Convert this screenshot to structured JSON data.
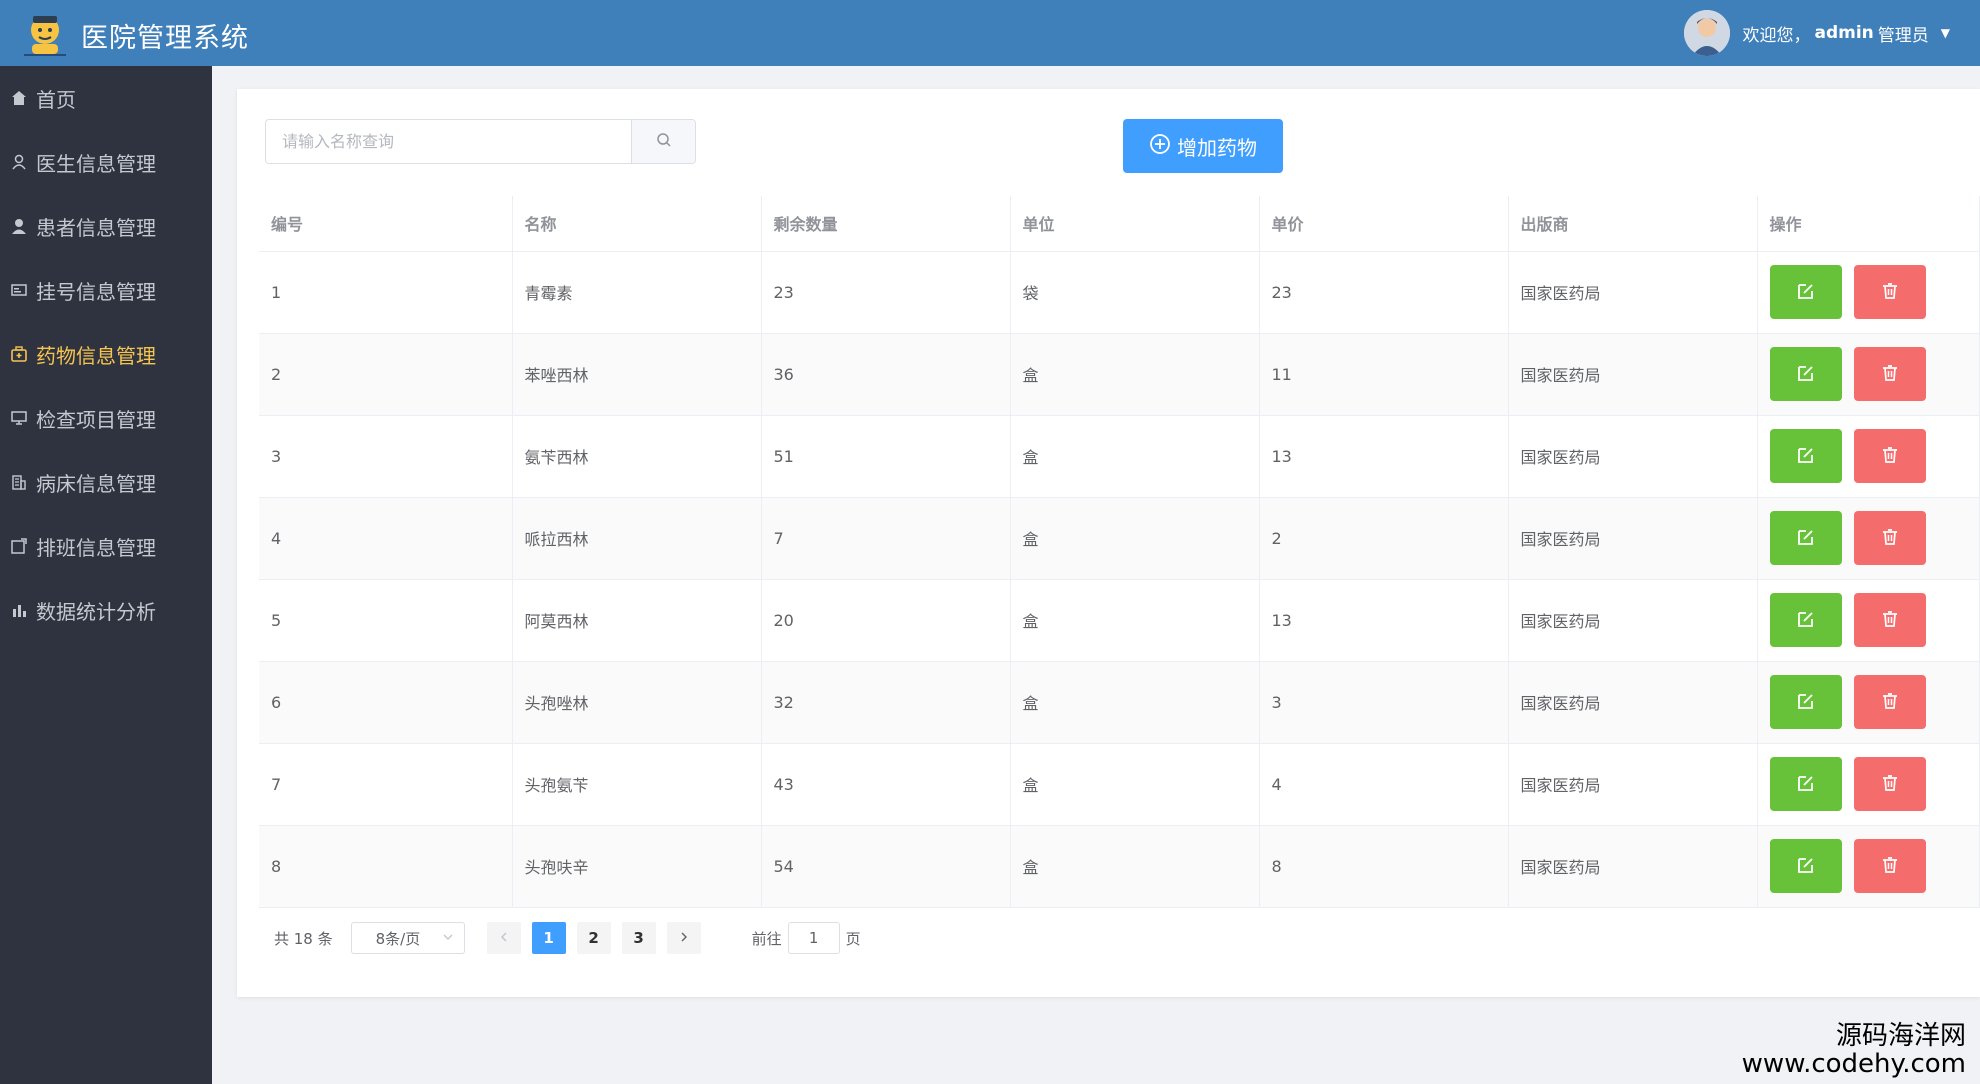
{
  "header": {
    "app_title": "医院管理系统",
    "welcome_prefix": "欢迎您，",
    "username": "admin",
    "role": "管理员"
  },
  "sidebar": {
    "items": [
      {
        "label": "首页",
        "icon": "home-icon"
      },
      {
        "label": "医生信息管理",
        "icon": "user-outline-icon"
      },
      {
        "label": "患者信息管理",
        "icon": "user-solid-icon"
      },
      {
        "label": "挂号信息管理",
        "icon": "postcard-icon"
      },
      {
        "label": "药物信息管理",
        "icon": "first-aid-icon",
        "active": true
      },
      {
        "label": "检查项目管理",
        "icon": "monitor-icon"
      },
      {
        "label": "病床信息管理",
        "icon": "office-building-icon"
      },
      {
        "label": "排班信息管理",
        "icon": "share-icon"
      },
      {
        "label": "数据统计分析",
        "icon": "bar-chart-icon"
      }
    ]
  },
  "search": {
    "placeholder": "请输入名称查询",
    "value": ""
  },
  "add_button": {
    "label": "增加药物"
  },
  "table": {
    "columns": [
      "编号",
      "名称",
      "剩余数量",
      "单位",
      "单价",
      "出版商",
      "操作"
    ],
    "rows": [
      {
        "id": "1",
        "name": "青霉素",
        "qty": "23",
        "unit": "袋",
        "price": "23",
        "maker": "国家医药局"
      },
      {
        "id": "2",
        "name": "苯唑西林",
        "qty": "36",
        "unit": "盒",
        "price": "11",
        "maker": "国家医药局"
      },
      {
        "id": "3",
        "name": "氨苄西林",
        "qty": "51",
        "unit": "盒",
        "price": "13",
        "maker": "国家医药局"
      },
      {
        "id": "4",
        "name": "哌拉西林",
        "qty": "7",
        "unit": "盒",
        "price": "2",
        "maker": "国家医药局"
      },
      {
        "id": "5",
        "name": "阿莫西林",
        "qty": "20",
        "unit": "盒",
        "price": "13",
        "maker": "国家医药局"
      },
      {
        "id": "6",
        "name": "头孢唑林",
        "qty": "32",
        "unit": "盒",
        "price": "3",
        "maker": "国家医药局"
      },
      {
        "id": "7",
        "name": "头孢氨苄",
        "qty": "43",
        "unit": "盒",
        "price": "4",
        "maker": "国家医药局"
      },
      {
        "id": "8",
        "name": "头孢呋辛",
        "qty": "54",
        "unit": "盒",
        "price": "8",
        "maker": "国家医药局"
      }
    ]
  },
  "pagination": {
    "total_text": "共 18 条",
    "page_size": "8条/页",
    "pages": [
      "1",
      "2",
      "3"
    ],
    "current_page": "1",
    "goto_prefix": "前往",
    "goto_value": "1",
    "goto_suffix": "页"
  },
  "watermark": {
    "line1": "源码海洋网",
    "line2": "www.codehy.com"
  },
  "colors": {
    "header": "#3f7fba",
    "sidebar": "#2f3340",
    "active": "#f5c451",
    "primary": "#409eff",
    "edit": "#67c23a",
    "delete": "#f56c6c"
  }
}
